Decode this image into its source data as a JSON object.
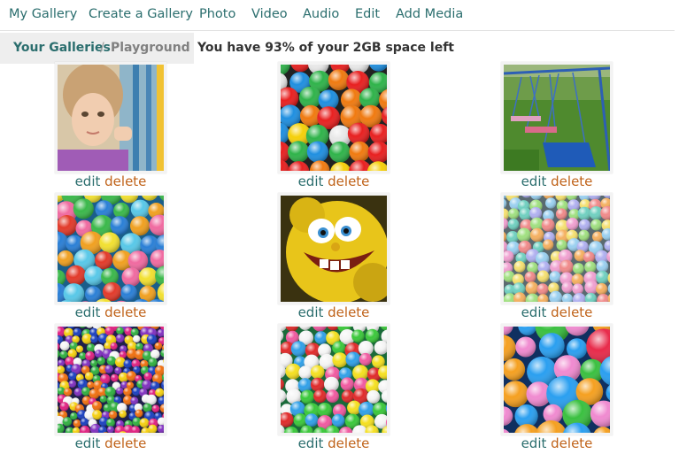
{
  "nav": {
    "items": [
      {
        "label": "My Gallery"
      },
      {
        "label": "Create a Gallery"
      },
      {
        "label": "Photo"
      },
      {
        "label": "Video"
      },
      {
        "label": "Audio"
      },
      {
        "label": "Edit"
      },
      {
        "label": "Add Media"
      }
    ]
  },
  "breadcrumb": {
    "parent": "Your Galleries",
    "separator": "/",
    "current": "Playground"
  },
  "space_message": "You have 93% of your 2GB space left",
  "gallery": {
    "edit_label": "edit",
    "delete_label": "delete",
    "photos": [
      {
        "subject": "child-on-swing"
      },
      {
        "subject": "colorful-balls"
      },
      {
        "subject": "blue-swings-on-grass"
      },
      {
        "subject": "ball-pit-balls"
      },
      {
        "subject": "yellow-cartoon-face"
      },
      {
        "subject": "pastel-ball-pit"
      },
      {
        "subject": "small-multicolor-balls"
      },
      {
        "subject": "bright-ball-pit"
      },
      {
        "subject": "ball-pit-closeup"
      }
    ]
  },
  "colors": {
    "link": "#2b6e6e",
    "delete": "#c0631a",
    "breadcrumb_bg": "#eeeeee"
  }
}
